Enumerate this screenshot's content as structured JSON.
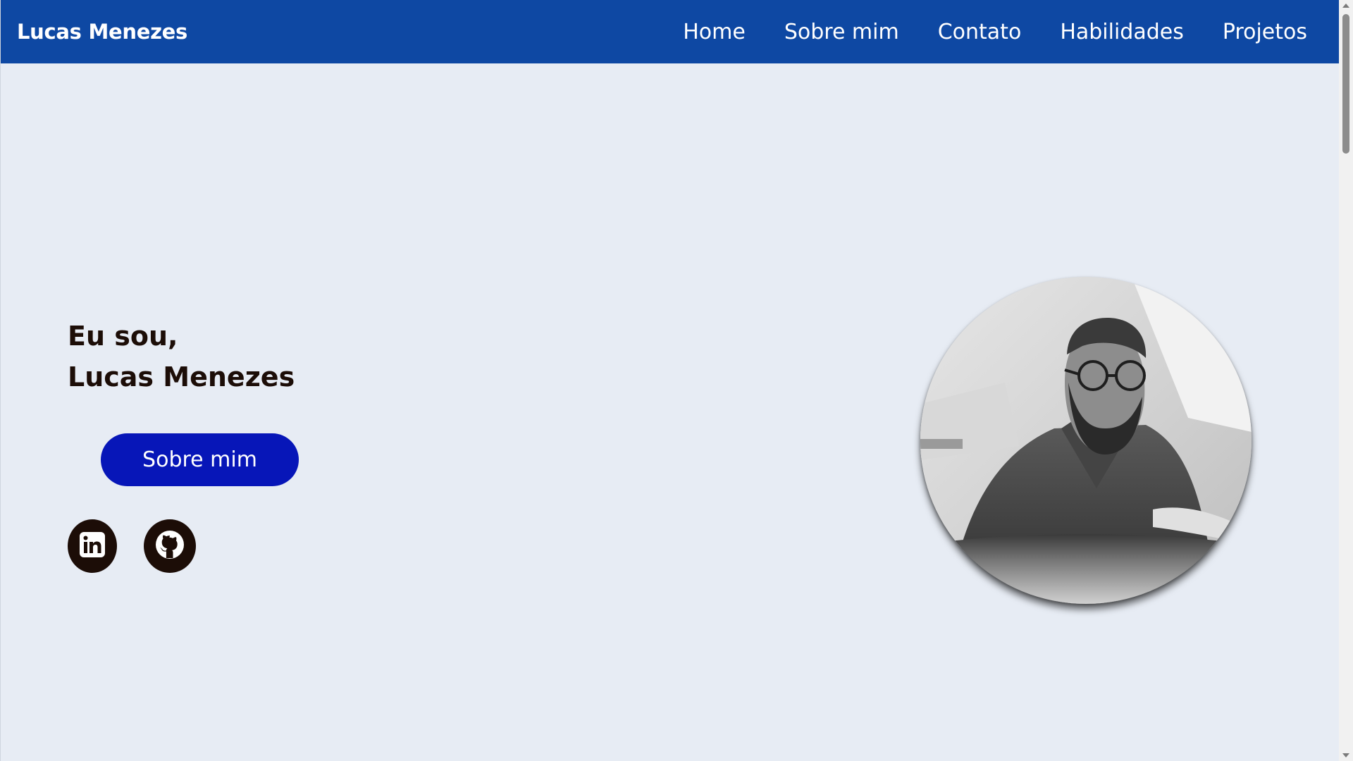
{
  "brand": "Lucas Menezes",
  "nav": [
    {
      "label": "Home"
    },
    {
      "label": "Sobre mim"
    },
    {
      "label": "Contato"
    },
    {
      "label": "Habilidades"
    },
    {
      "label": "Projetos"
    }
  ],
  "hero": {
    "greeting": "Eu sou,",
    "name": "Lucas Menezes",
    "button_label": "Sobre mim"
  },
  "social": [
    {
      "icon": "linkedin-icon"
    },
    {
      "icon": "github-icon"
    }
  ],
  "colors": {
    "nav_background": "#0e48a3",
    "page_background": "#e7ecf4",
    "button_background": "#0716b8",
    "text_dark": "#1c0d07"
  }
}
